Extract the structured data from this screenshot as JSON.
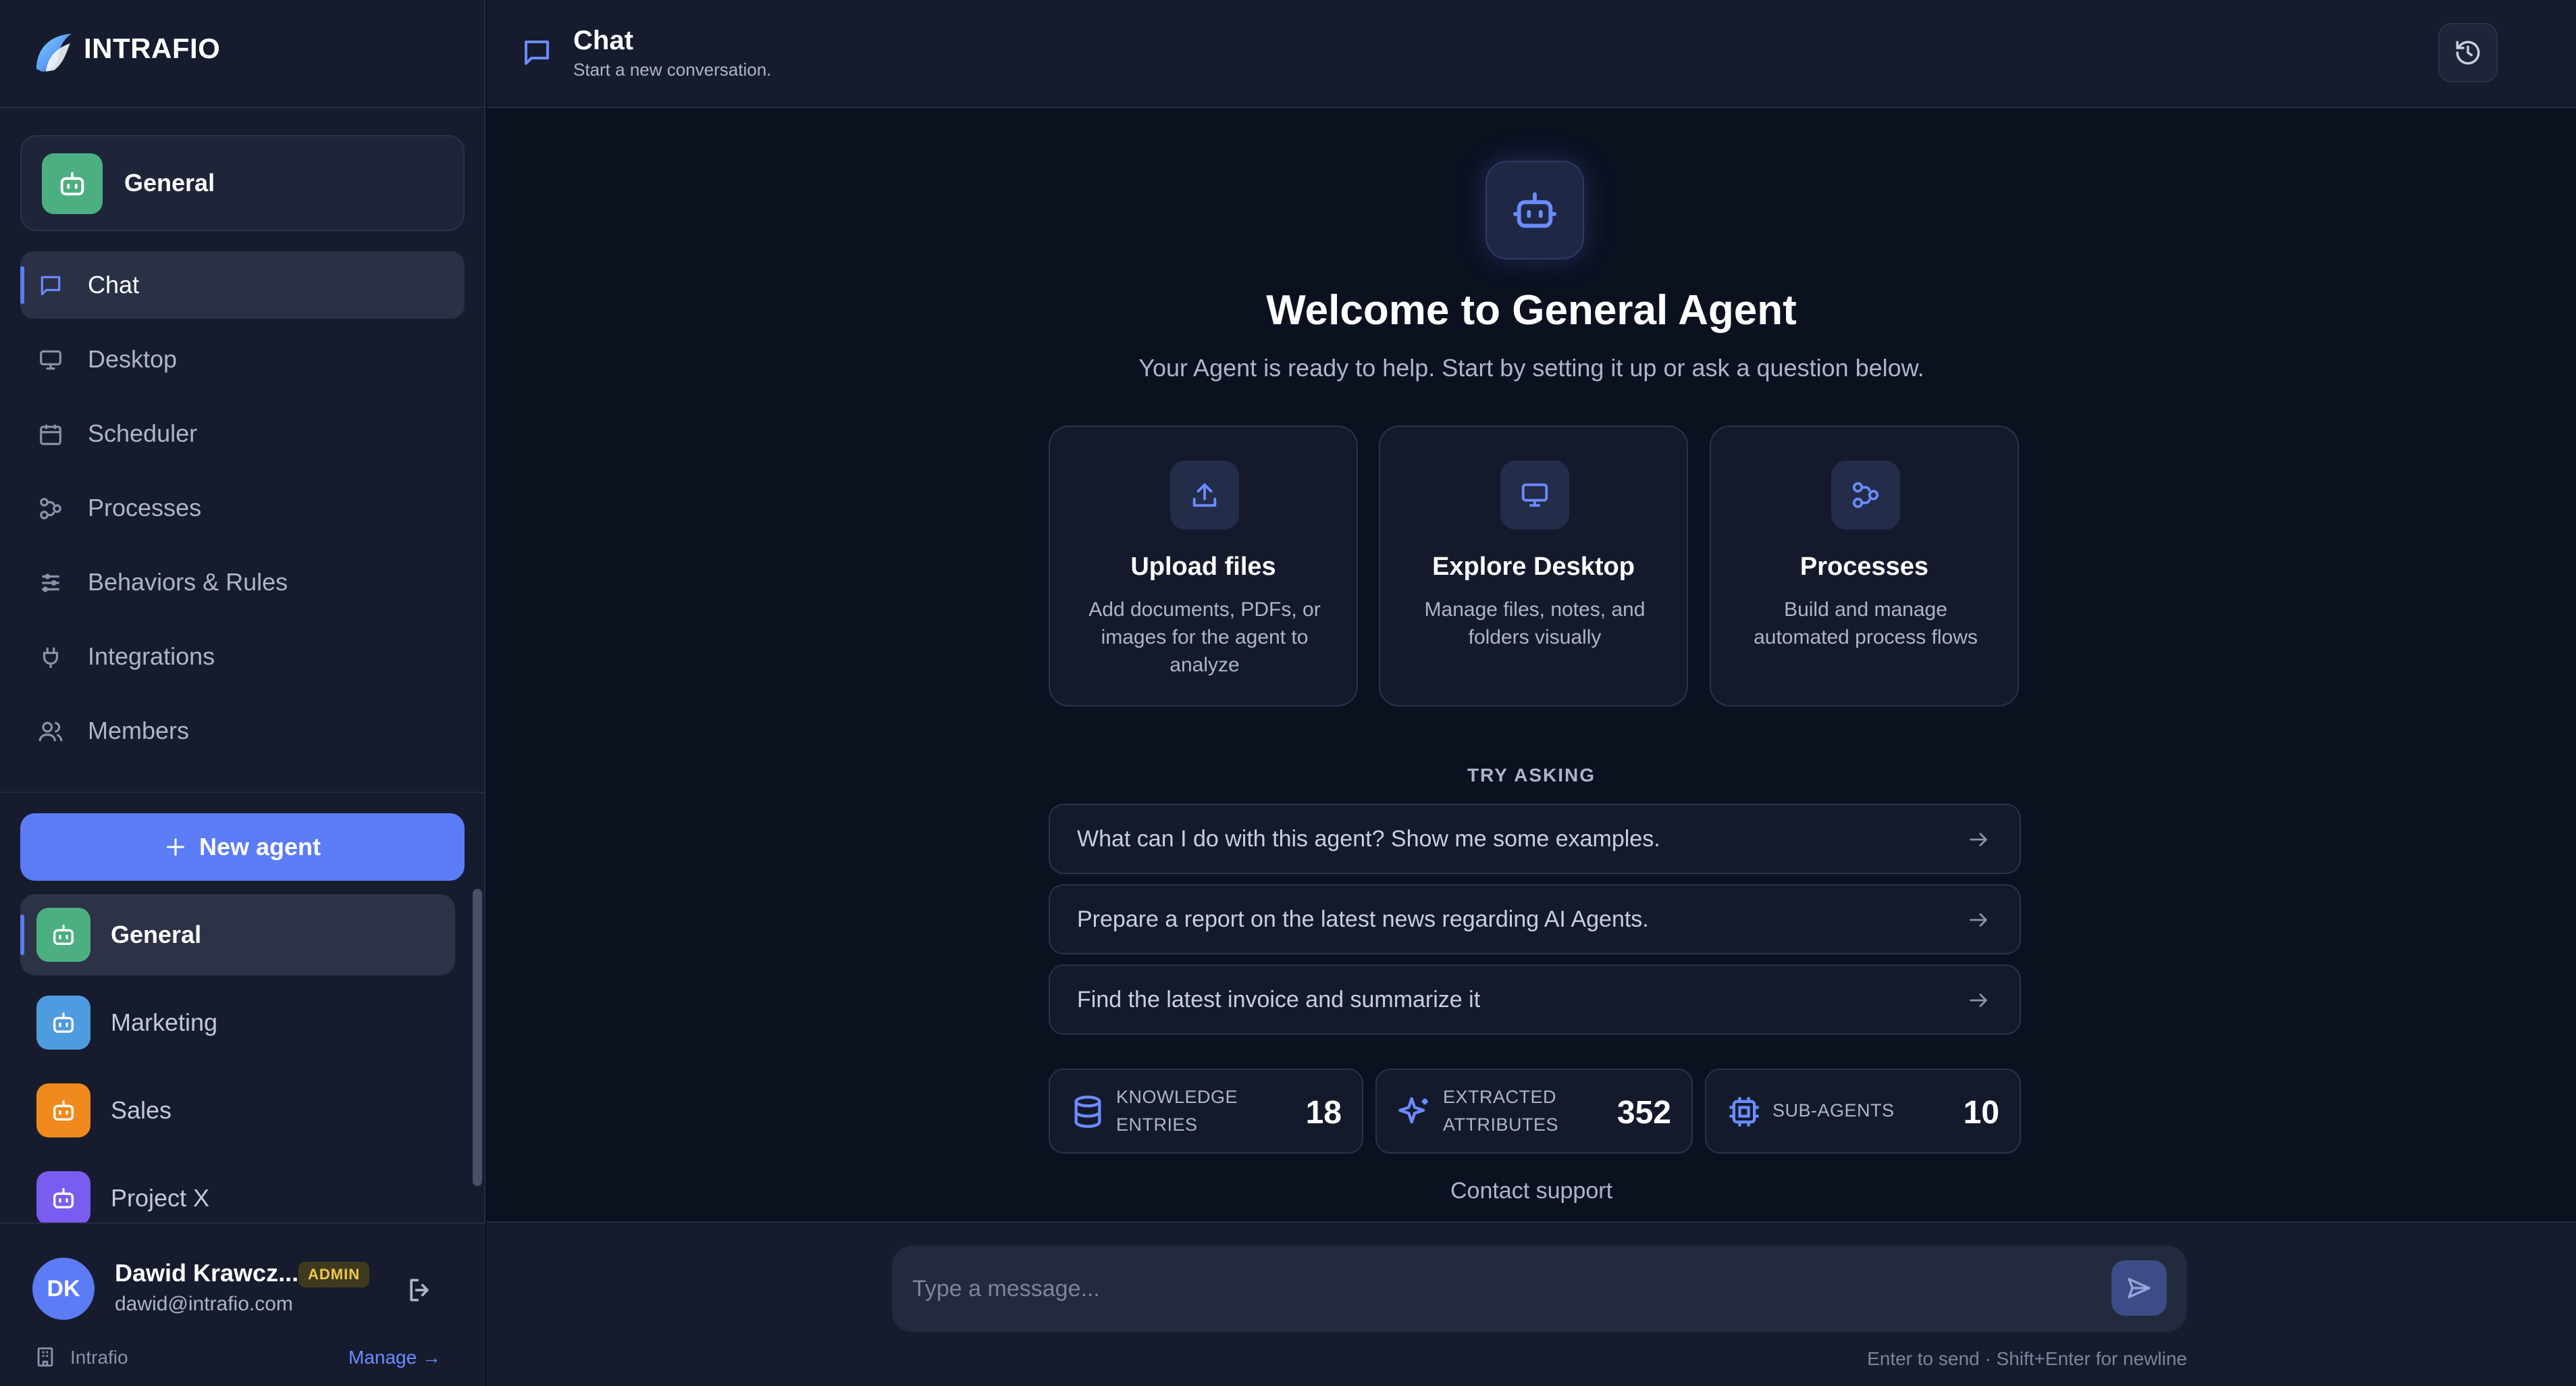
{
  "app": {
    "name": "INTRAFIO"
  },
  "current_agent": {
    "name": "General"
  },
  "nav": [
    {
      "label": "Chat",
      "icon": "chat-icon",
      "active": true
    },
    {
      "label": "Desktop",
      "icon": "monitor-icon"
    },
    {
      "label": "Scheduler",
      "icon": "calendar-icon"
    },
    {
      "label": "Processes",
      "icon": "workflow-icon"
    },
    {
      "label": "Behaviors & Rules",
      "icon": "sliders-icon"
    },
    {
      "label": "Integrations",
      "icon": "plug-icon"
    },
    {
      "label": "Members",
      "icon": "users-icon"
    }
  ],
  "new_agent_label": "New agent",
  "agents": [
    {
      "name": "General",
      "color": "#4caf82",
      "active": true
    },
    {
      "name": "Marketing",
      "color": "#4f9be0"
    },
    {
      "name": "Sales",
      "color": "#f08a1c"
    },
    {
      "name": "Project X",
      "color": "#7b5cf0"
    }
  ],
  "user": {
    "initials": "DK",
    "name": "Dawid Krawcz...",
    "role": "ADMIN",
    "email": "dawid@intrafio.com",
    "org": "Intrafio",
    "manage_label": "Manage →"
  },
  "header": {
    "title": "Chat",
    "subtitle": "Start a new conversation."
  },
  "welcome": {
    "title": "Welcome to General Agent",
    "subtitle": "Your Agent is ready to help. Start by setting it up or ask a question below."
  },
  "features": [
    {
      "title": "Upload files",
      "desc": "Add documents, PDFs, or images for the agent to analyze",
      "icon": "upload-icon"
    },
    {
      "title": "Explore Desktop",
      "desc": "Manage files, notes, and folders visually",
      "icon": "monitor-icon"
    },
    {
      "title": "Processes",
      "desc": "Build and manage automated process flows",
      "icon": "workflow-icon"
    }
  ],
  "try_label": "TRY ASKING",
  "prompts": [
    "What can I do with this agent? Show me some examples.",
    "Prepare a report on the latest news regarding AI Agents.",
    "Find the latest invoice and summarize it"
  ],
  "stats": [
    {
      "line1": "KNOWLEDGE",
      "line2": "ENTRIES",
      "value": "18",
      "icon": "database-icon"
    },
    {
      "line1": "EXTRACTED",
      "line2": "ATTRIBUTES",
      "value": "352",
      "icon": "sparkle-icon"
    },
    {
      "line1": "SUB-AGENTS",
      "line2": "",
      "value": "10",
      "icon": "chip-icon"
    }
  ],
  "contact_label": "Contact support",
  "composer": {
    "placeholder": "Type a message...",
    "hint": "Enter to send · Shift+Enter for newline"
  },
  "colors": {
    "accent": "#5b7cf5",
    "bg": "#0c1120",
    "sidebar": "#161c2e"
  }
}
